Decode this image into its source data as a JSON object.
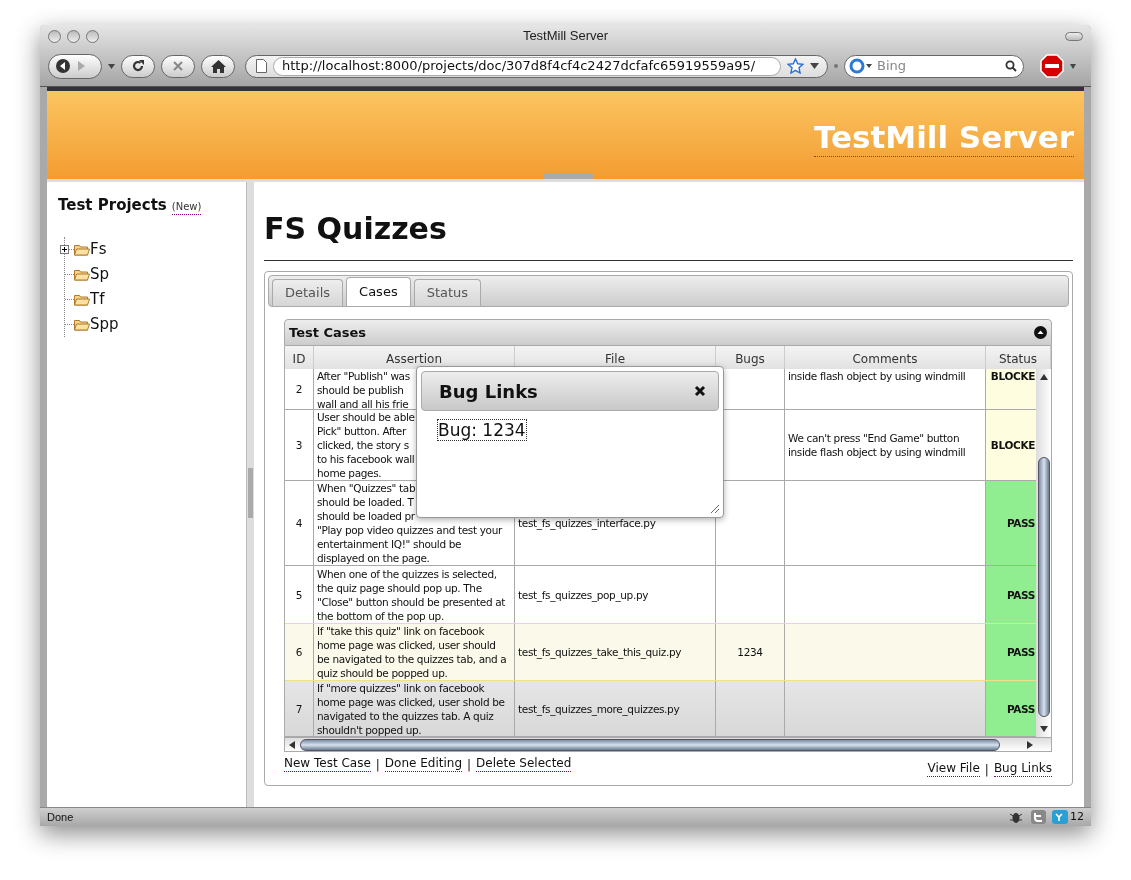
{
  "window": {
    "title": "TestMill Server"
  },
  "toolbar": {
    "url": "http://localhost:8000/projects/doc/307d8f4cf4c2427dcfafc65919559a95/",
    "search_placeholder": "Bing"
  },
  "header": {
    "title": "TestMill Server"
  },
  "sidebar": {
    "title": "Test Projects",
    "new_link": "(New)",
    "tree": [
      {
        "label": "Fs",
        "expandable": true
      },
      {
        "label": "Sp",
        "expandable": false
      },
      {
        "label": "Tf",
        "expandable": false
      },
      {
        "label": "Spp",
        "expandable": false
      }
    ]
  },
  "page": {
    "title": "FS Quizzes",
    "tabs": [
      {
        "label": "Details",
        "selected": false
      },
      {
        "label": "Cases",
        "selected": true
      },
      {
        "label": "Status",
        "selected": false
      }
    ]
  },
  "grid": {
    "title": "Test Cases",
    "columns": [
      "ID",
      "Assertion",
      "File",
      "Bugs",
      "Comments",
      "Status"
    ],
    "rows": [
      {
        "id": "2",
        "assertion": [
          "After \"Publish\" was",
          "should be publish",
          "wall and all his frie"
        ],
        "comments": [
          "inside flash object by using windmill"
        ],
        "status": "BLOCKE",
        "color": "#fffde0",
        "selected": false,
        "highlighted": false
      },
      {
        "id": "3",
        "assertion": [
          "User should be able",
          "Pick\" button. After",
          "clicked, the story s",
          "to his facebook wall",
          "home pages."
        ],
        "comments": [
          "We can't press \"End Game\" button",
          "inside flash object by using windmill"
        ],
        "status": "BLOCKE",
        "color": "#fffde0",
        "selected": false,
        "highlighted": false
      },
      {
        "id": "4",
        "assertion": [
          "When \"Quizzes\" tab",
          "should be loaded. T",
          "should be loaded pr",
          "\"Play pop video quizzes and test your",
          "entertainment IQ!\" should be",
          "displayed on the page."
        ],
        "file": "test_fs_quizzes_interface.py",
        "status": "PASS",
        "color": "#90ee90",
        "selected": false,
        "highlighted": false
      },
      {
        "id": "5",
        "assertion": [
          "When one of the quizzes is selected,",
          "the quiz page should pop up. The",
          "\"Close\" button should be presented at",
          "the bottom of the pop up."
        ],
        "file": "test_fs_quizzes_pop_up.py",
        "status": "PASS",
        "color": "#90ee90",
        "selected": false,
        "highlighted": false
      },
      {
        "id": "6",
        "assertion": [
          "If \"take this quiz\" link on facebook",
          "home page was clicked, user should",
          "be navigated to the quizzes tab, and a",
          "quiz should be popped up."
        ],
        "file": "test_fs_quizzes_take_this_quiz.py",
        "bugs": "1234",
        "status": "PASS",
        "color": "#90ee90",
        "selected": false,
        "highlighted": true
      },
      {
        "id": "7",
        "assertion": [
          "If \"more quizzes\" link on facebook",
          "home page was clicked, user shold be",
          "navigated to the quizzes tab. A quiz",
          "shouldn't popped up."
        ],
        "file": "test_fs_quizzes_more_quizzes.py",
        "status": "PASS",
        "color": "#90ee90",
        "selected": true,
        "highlighted": false
      }
    ]
  },
  "footer_left": [
    {
      "kind": "link",
      "text": "New Test Case"
    },
    {
      "kind": "separator",
      "text": "|"
    },
    {
      "kind": "link",
      "text": "Done Editing"
    },
    {
      "kind": "separator",
      "text": "|"
    },
    {
      "kind": "link",
      "text": "Delete Selected"
    }
  ],
  "footer_right": [
    {
      "kind": "link",
      "text": "View File"
    },
    {
      "kind": "separator",
      "text": "|"
    },
    {
      "kind": "link",
      "text": "Bug Links"
    }
  ],
  "dialog": {
    "title": "Bug Links",
    "link": "Bug: 1234"
  },
  "status_bar": {
    "text": "Done",
    "badge": "12"
  }
}
